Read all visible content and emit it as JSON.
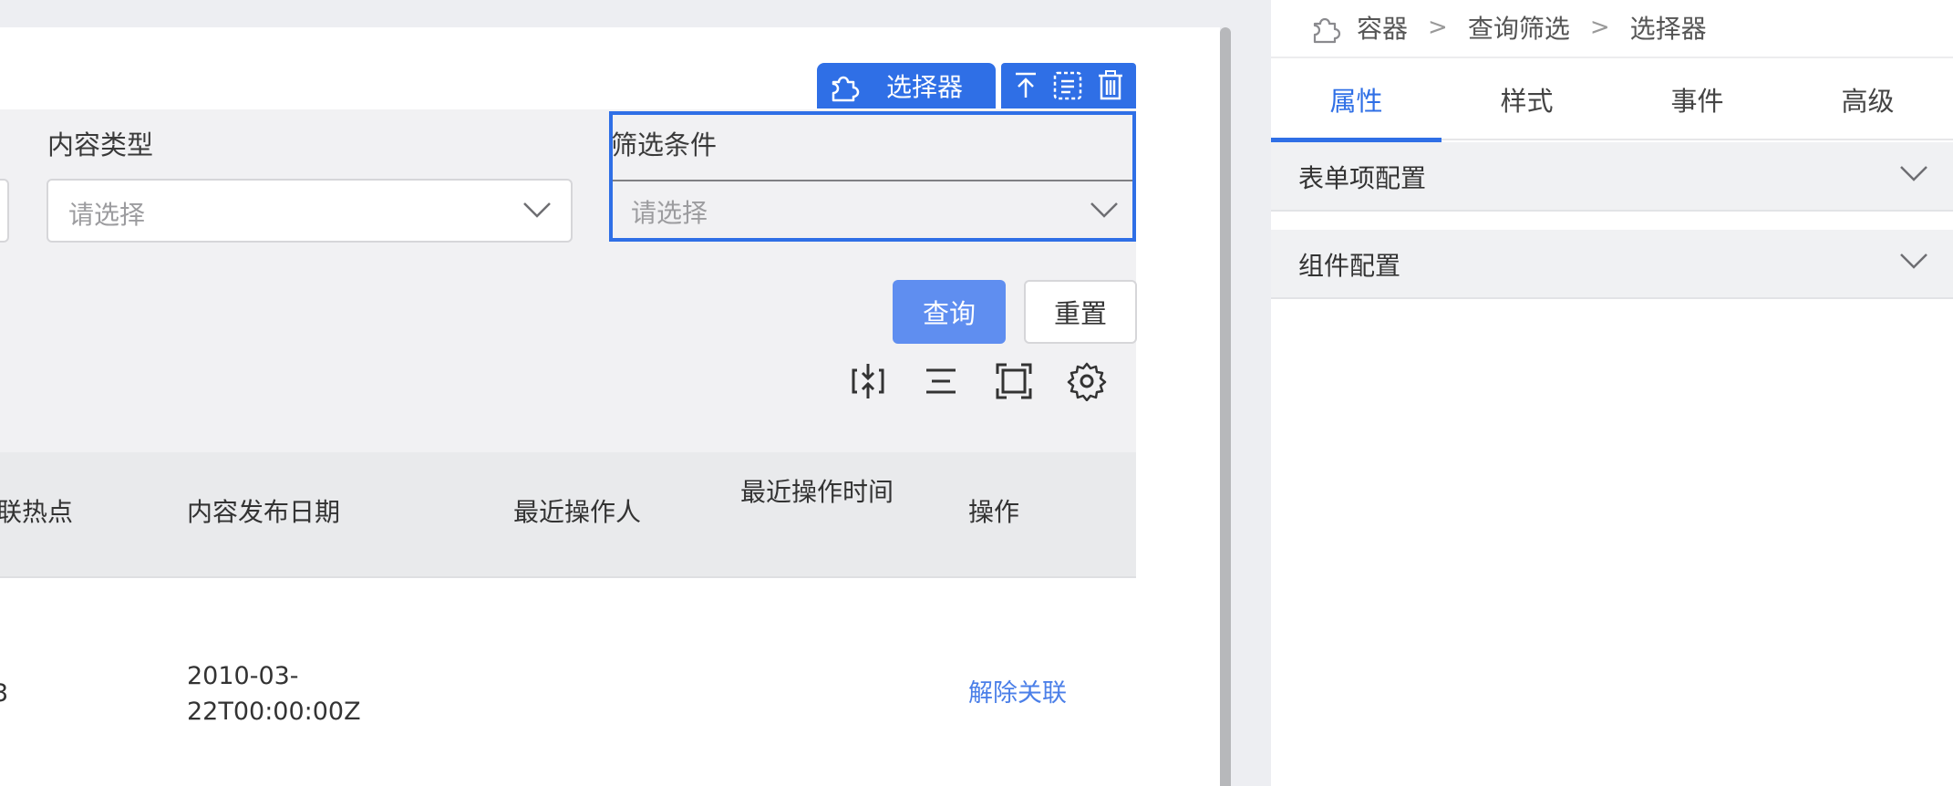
{
  "form": {
    "content_type_label": "内容类型",
    "content_type_placeholder": "请选择",
    "filter_label": "筛选条件",
    "filter_placeholder": "请选择",
    "query_button": "查询",
    "reset_button": "重置"
  },
  "selection_tag": {
    "label": "选择器"
  },
  "toolbar_icons": [
    "compress-icon",
    "density-icon",
    "fullscreen-icon",
    "settings-icon"
  ],
  "table": {
    "headers": [
      "联热点",
      "内容发布日期",
      "最近操作人",
      "最近操作时间",
      "操作"
    ],
    "rows": [
      {
        "partial": "3",
        "publish_date_line1": "2010-03-",
        "publish_date_line2": "22T00:00:00Z",
        "operator": "",
        "time": "",
        "action": "解除关联"
      }
    ]
  },
  "right_panel": {
    "breadcrumb": [
      "容器",
      "查询筛选",
      "选择器"
    ],
    "breadcrumb_separator": ">",
    "tabs": [
      "属性",
      "样式",
      "事件",
      "高级"
    ],
    "active_tab": "属性",
    "sections": [
      "表单项配置",
      "组件配置"
    ]
  },
  "colors": {
    "accent": "#2f6fe6",
    "primary_button": "#5f8ef0",
    "link": "#4b7fe8"
  }
}
